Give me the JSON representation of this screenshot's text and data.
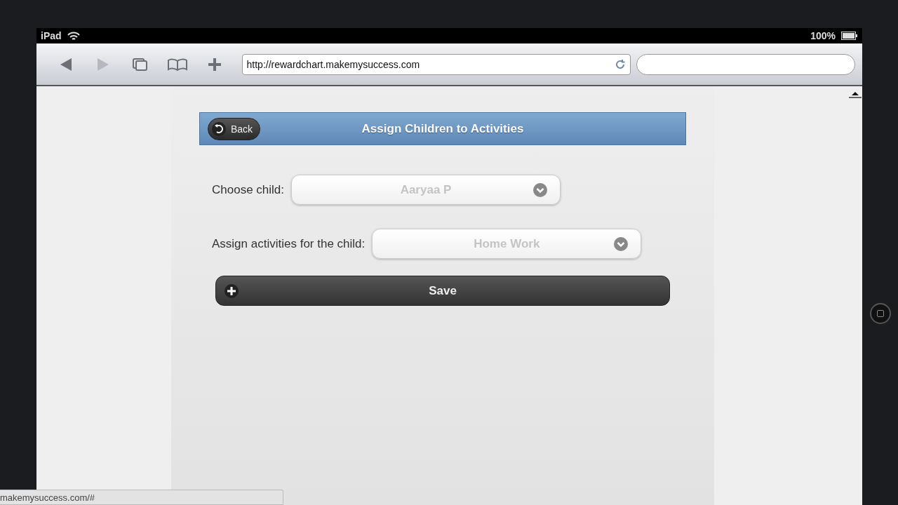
{
  "status_bar": {
    "device": "iPad",
    "battery": "100%"
  },
  "toolbar": {
    "back_disabled": false,
    "forward_disabled": true,
    "url": "http://rewardchart.makemysuccess.com"
  },
  "page": {
    "header": {
      "back_button": "Back",
      "title": "Assign Children to Activities"
    },
    "fields": [
      {
        "label": "Choose child:",
        "value": "Aaryaa P"
      },
      {
        "label": "Assign activities for the child:",
        "value": "Home Work"
      }
    ],
    "save_button": "Save"
  },
  "link_preview": "makemysuccess.com/#"
}
